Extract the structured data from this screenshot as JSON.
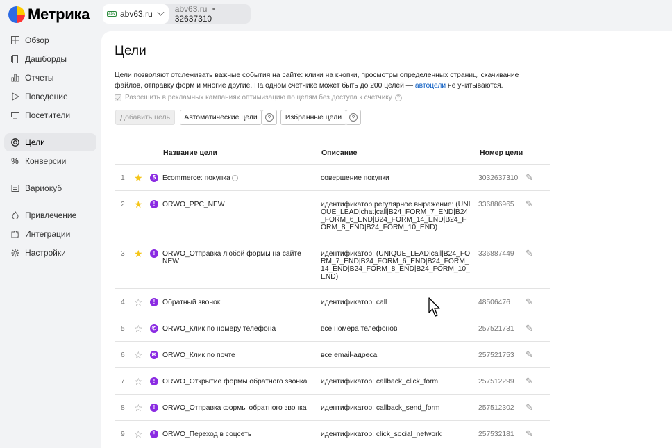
{
  "header": {
    "logo_text": "Метрика",
    "counter": {
      "site": "abv63.ru",
      "site_meta": "abv63.ru",
      "separator": "•",
      "counter_id": "32637310"
    }
  },
  "sidebar": {
    "items": [
      {
        "label": "Обзор",
        "icon": "grid-icon"
      },
      {
        "label": "Дашборды",
        "icon": "dashboard-icon"
      },
      {
        "label": "Отчеты",
        "icon": "bar-chart-icon"
      },
      {
        "label": "Поведение",
        "icon": "play-icon"
      },
      {
        "label": "Посетители",
        "icon": "monitor-icon"
      },
      {
        "label": "Цели",
        "icon": "target-icon",
        "active": true
      },
      {
        "label": "Конверсии",
        "icon": "percent-icon"
      },
      {
        "label": "Вариокуб",
        "icon": "cube-icon"
      },
      {
        "label": "Привлечение",
        "icon": "flame-icon"
      },
      {
        "label": "Интеграции",
        "icon": "puzzle-icon"
      },
      {
        "label": "Настройки",
        "icon": "gear-icon"
      }
    ]
  },
  "main": {
    "title": "Цели",
    "desc_part1": "Цели позволяют отслеживать важные события на сайте: клики на кнопки, просмотры определенных страниц, скачивание файлов, отправку форм и многие другие. На одном счетчике может быть до 200 целей — ",
    "desc_link": "автоцели",
    "desc_part2": " не учитываются.",
    "permission_label": "Разрешить в рекламных кампаниях оптимизацию по целям без доступа к счетчику",
    "buttons": {
      "add": "Добавить цель",
      "auto": "Автоматические цели",
      "favorites": "Избранные цели",
      "help": "?"
    },
    "table": {
      "headers": {
        "name": "Название цели",
        "description": "Описание",
        "number": "Номер цели"
      },
      "rows": [
        {
          "n": "1",
          "starred": true,
          "icon": "$",
          "name": "Ecommerce: покупка",
          "info": true,
          "desc": "совершение покупки",
          "id": "3032637310"
        },
        {
          "n": "2",
          "starred": true,
          "icon": "!",
          "name": "ORWO_PPC_NEW",
          "desc": "идентификатор регулярное выражение: (UNIQUE_LEAD|chat|call|B24_FORM_7_END|B24_FORM_6_END|B24_FORM_14_END|B24_FORM_8_END|B24_FORM_10_END)",
          "id": "336886965"
        },
        {
          "n": "3",
          "starred": true,
          "icon": "!",
          "name": "ORWO_Отправка любой формы на сайте NEW",
          "desc": "идентификатор: (UNIQUE_LEAD|call|B24_FORM_7_END|B24_FORM_6_END|B24_FORM_14_END|B24_FORM_8_END|B24_FORM_10_END)",
          "id": "336887449"
        },
        {
          "n": "4",
          "starred": false,
          "icon": "!",
          "name": "Обратный звонок",
          "desc": "идентификатор: call",
          "id": "48506476"
        },
        {
          "n": "5",
          "starred": false,
          "icon": "✆",
          "name": "ORWO_Клик по номеру телефона",
          "desc": "все номера телефонов",
          "id": "257521731"
        },
        {
          "n": "6",
          "starred": false,
          "icon": "✉",
          "name": "ORWO_Клик по почте",
          "desc": "все email-адреса",
          "id": "257521753"
        },
        {
          "n": "7",
          "starred": false,
          "icon": "!",
          "name": "ORWO_Открытие формы обратного звонка",
          "desc": "идентификатор: callback_click_form",
          "id": "257512299"
        },
        {
          "n": "8",
          "starred": false,
          "icon": "!",
          "name": "ORWO_Отправка формы обратного звонка",
          "desc": "идентификатор: callback_send_form",
          "id": "257512302"
        },
        {
          "n": "9",
          "starred": false,
          "icon": "!",
          "name": "ORWO_Переход в соцсеть",
          "desc": "идентификатор: click_social_network",
          "id": "257532181"
        }
      ]
    }
  },
  "colors": {
    "accent_link": "#0a5cc2",
    "star": "#f5c518",
    "goal_icon": "#8a2be2"
  }
}
